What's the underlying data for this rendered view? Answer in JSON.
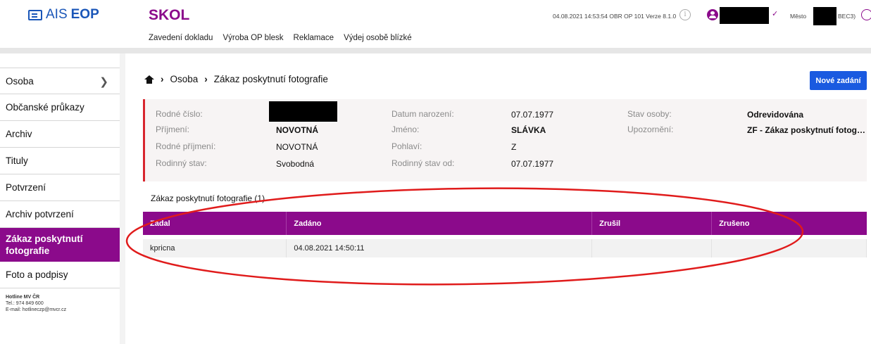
{
  "header": {
    "logo_prefix": "AIS",
    "logo_brand": "EOP",
    "app_title": "SKOL",
    "nav": [
      "Zavedení dokladu",
      "Výroba OP blesk",
      "Reklamace",
      "Výdej osobě blízké"
    ],
    "session_info": "04.08.2021 14:53:54 OBR OP 101 Verze 8.1.0",
    "city_label": "Město",
    "city_code": "BEC3)",
    "icons": {
      "info": "info-icon",
      "user": "user-icon",
      "chevron": "chevron-down-icon",
      "logout": "logout-icon"
    }
  },
  "sidebar": {
    "items": [
      {
        "label": "Osoba",
        "has_chevron": true
      },
      {
        "label": "Občanské průkazy"
      },
      {
        "label": "Archiv"
      },
      {
        "label": "Tituly"
      },
      {
        "label": "Potvrzení"
      },
      {
        "label": "Archiv potvrzení"
      },
      {
        "label": "Zákaz poskytnutí fotografie",
        "active": true
      },
      {
        "label": "Foto a podpisy"
      }
    ],
    "hotline": {
      "title": "Hotline MV ČR",
      "phone": "Tel.: 974 849 600",
      "email": "E-mail: hotlineczp@mvcr.cz"
    }
  },
  "breadcrumb": {
    "items": [
      "Osoba",
      "Zákaz poskytnutí fotografie"
    ]
  },
  "new_button_label": "Nové zadání",
  "person": {
    "rodne_cislo_label": "Rodné číslo:",
    "prijmeni_label": "Příjmení:",
    "prijmeni": "NOVOTNÁ",
    "rodne_prijmeni_label": "Rodné příjmení:",
    "rodne_prijmeni": "NOVOTNÁ",
    "rodinny_stav_label": "Rodinný stav:",
    "rodinny_stav": "Svobodná",
    "datum_narozeni_label": "Datum narození:",
    "datum_narozeni": "07.07.1977",
    "jmeno_label": "Jméno:",
    "jmeno": "SLÁVKA",
    "pohlavi_label": "Pohlaví:",
    "pohlavi": "Z",
    "rodinny_stav_od_label": "Rodinný stav od:",
    "rodinny_stav_od": "07.07.1977",
    "stav_osoby_label": "Stav osoby:",
    "stav_osoby": "Odrevidována",
    "upozorneni_label": "Upozornění:",
    "upozorneni": "ZF - Zákaz poskytnutí fotog…"
  },
  "section_title": "Zákaz poskytnutí fotografie (1)",
  "table": {
    "columns": [
      "Zadal",
      "Zadáno",
      "Zrušil",
      "Zrušeno"
    ],
    "rows": [
      {
        "zadal": "kpricna",
        "zadano": "04.08.2021 14:50:11",
        "zrusil": "",
        "zruseno": ""
      }
    ]
  },
  "colors": {
    "accent": "#8b0a8b",
    "button": "#1a5ae0",
    "alert_border": "#d8262e",
    "annotation": "#e01b1b"
  }
}
